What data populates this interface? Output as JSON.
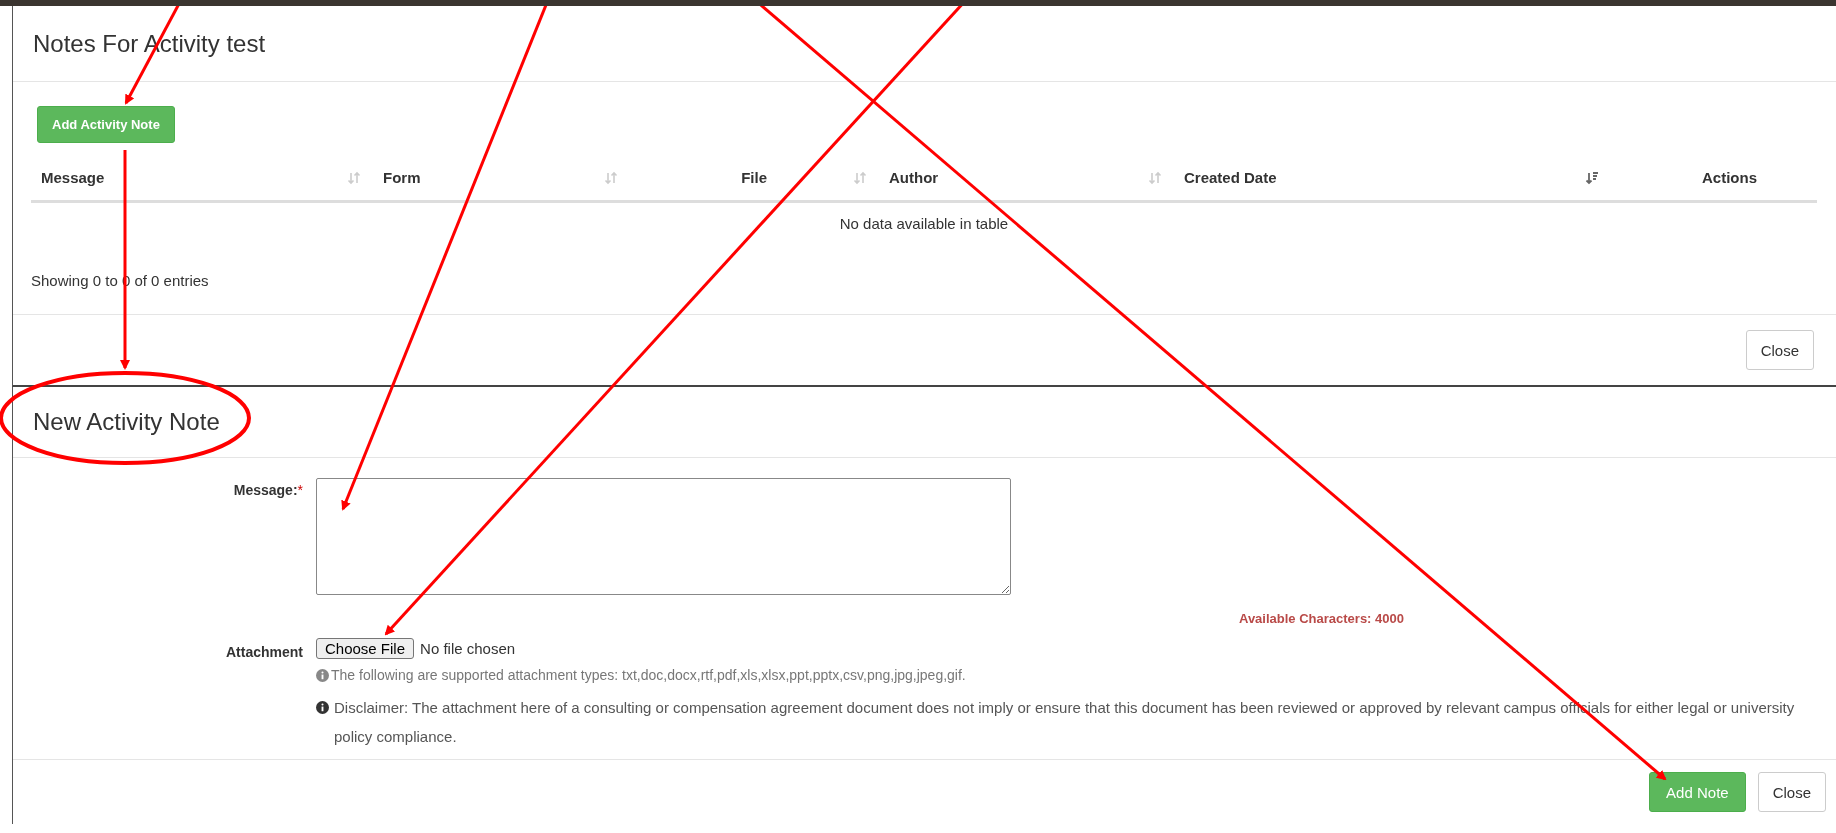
{
  "notes_modal": {
    "title": "Notes For Activity test",
    "add_button": "Add Activity Note",
    "table": {
      "columns": [
        {
          "label": "Message",
          "sortable": true,
          "sorted": false
        },
        {
          "label": "Form",
          "sortable": true,
          "sorted": false
        },
        {
          "label": "File",
          "sortable": true,
          "sorted": false
        },
        {
          "label": "Author",
          "sortable": true,
          "sorted": false
        },
        {
          "label": "Created Date",
          "sortable": true,
          "sorted": true
        },
        {
          "label": "Actions",
          "sortable": false
        }
      ],
      "empty_text": "No data available in table"
    },
    "info": "Showing 0 to 0 of 0 entries",
    "close_button": "Close"
  },
  "new_note_modal": {
    "title": "New Activity Note",
    "message_label": "Message:",
    "required_mark": "*",
    "available_characters": "Available Characters: 4000",
    "attachment_label": "Attachment",
    "choose_file_button": "Choose File",
    "file_status": "No file chosen",
    "supported_types": "The following are supported attachment types: txt,doc,docx,rtf,pdf,xls,xlsx,ppt,pptx,csv,png,jpg,jpeg,gif.",
    "disclaimer": "Disclaimer: The attachment here of a consulting or compensation agreement document does not imply or ensure that this document has been reviewed or approved by relevant campus officials for either legal or university policy compliance.",
    "buttons": [
      {
        "label": "Add Note",
        "kind": "primary"
      },
      {
        "label": "Close",
        "kind": "default"
      }
    ]
  }
}
